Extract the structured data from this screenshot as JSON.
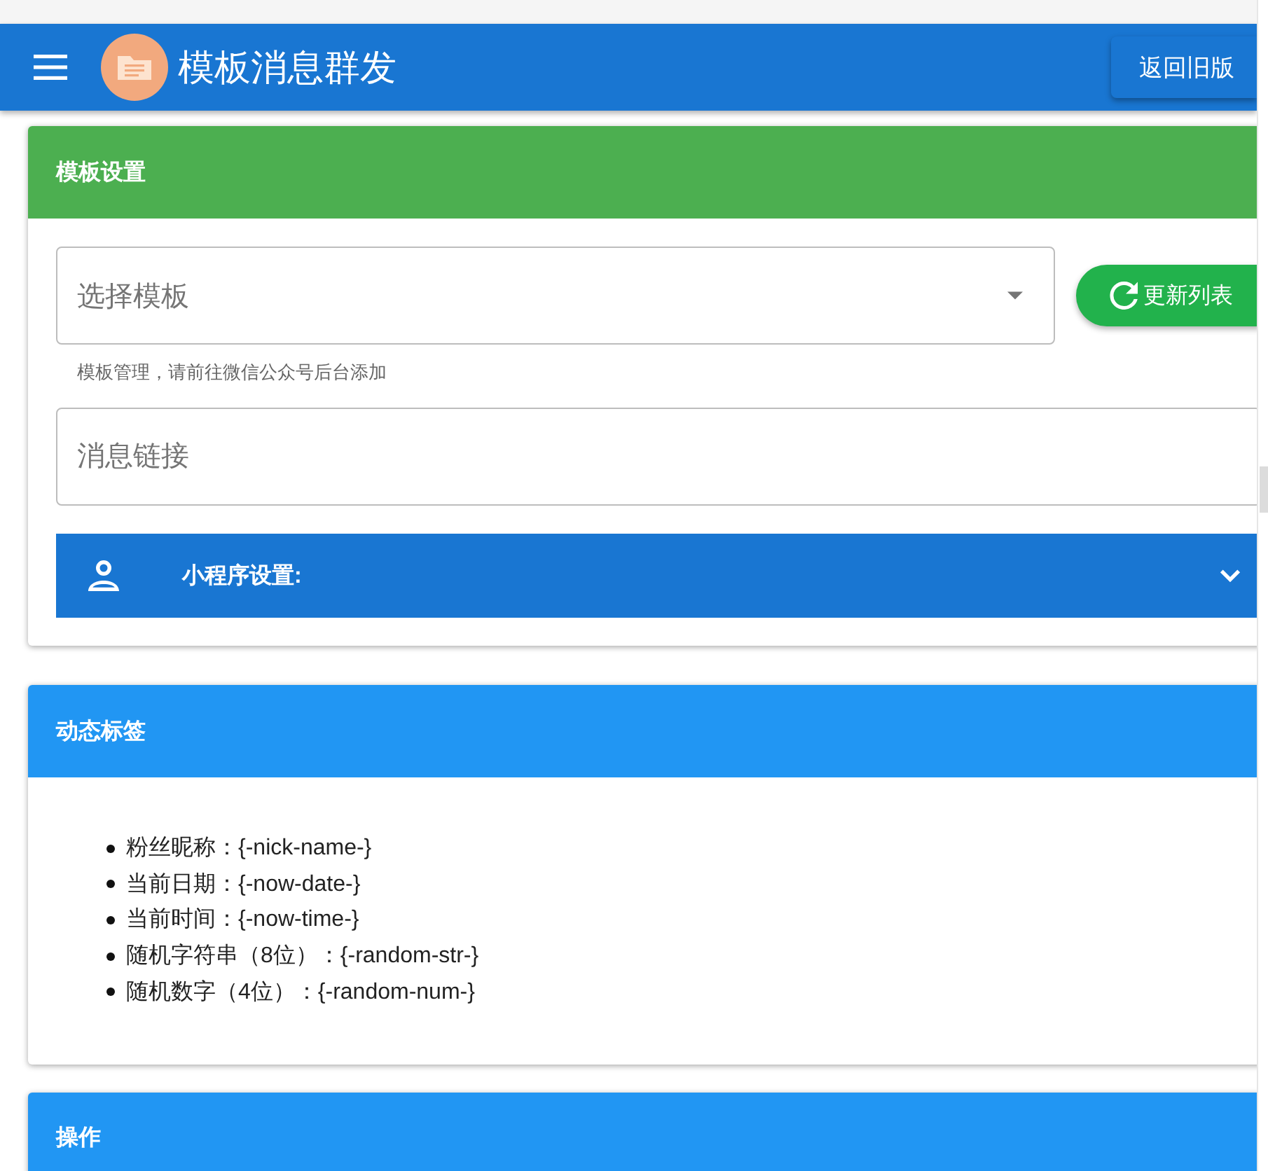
{
  "top_bar": {
    "title": "模板消息群发",
    "back_button": "返回旧版"
  },
  "template_settings": {
    "title": "模板设置",
    "template_select": {
      "placeholder": "选择模板"
    },
    "refresh_button": "更新列表",
    "hint": "模板管理，请前往微信公众号后台添加",
    "link_field": {
      "placeholder": "消息链接"
    },
    "mini_program_panel": {
      "label": "小程序设置:",
      "expanded": false
    }
  },
  "dynamic_tags": {
    "title": "动态标签",
    "items": [
      "粉丝昵称：{-nick-name-}",
      "当前日期：{-now-date-}",
      "当前时间：{-now-time-}",
      "随机字符串（8位）：{-random-str-}",
      "随机数字（4位）：{-random-num-}"
    ]
  },
  "actions": {
    "title": "操作"
  }
}
